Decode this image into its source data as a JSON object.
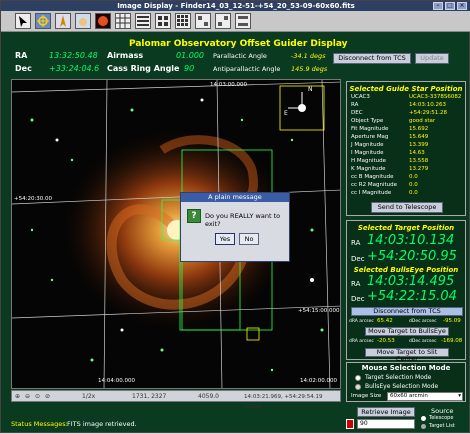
{
  "window": {
    "title": "Image Display - Finder14_03_12-51-+54_20_53-09-60x60.fits"
  },
  "toolbar": {
    "icons": [
      "pointer-icon",
      "crosshair-icon",
      "compass-icon",
      "hand-icon",
      "circle-icon",
      "grid-icon",
      "table-icon",
      "table-2-icon",
      "grid-3-icon",
      "grid-4-icon",
      "grid-5-icon",
      "grid-6-icon",
      "layout-icon"
    ]
  },
  "header": {
    "title": "Palomar Observatory Offset Guider Display",
    "ra_label": "RA",
    "ra_value": "13:32:50.48",
    "dec_label": "Dec",
    "dec_value": "+33:24:04.6",
    "airmass_label": "Airmass",
    "airmass_value": "01.000",
    "cass_label": "Cass Ring Angle",
    "cass_value": "90",
    "parallactic_label": "Parallactic Angle",
    "parallactic_value": "-34.1 degs",
    "antiparallactic_label": "Antiparallactic Angle",
    "antiparallactic_value": "145.9 degs",
    "disconnect_label": "Disconnect from TCS",
    "update_label": "Update"
  },
  "image": {
    "grid_labels": {
      "top": "14:03:00.000",
      "left": "+54:20:30.00",
      "right": "+54:15:00.000",
      "bottom_left": "14:04:00.000",
      "bottom_right": "14:02:00.000"
    },
    "compass": {
      "n": "N",
      "e": "E"
    },
    "zoom": "1/2x",
    "pixel": "1731, 2327",
    "value": "4059.0",
    "coords": "14:03:21.969, +54:29:54.19 (2000)"
  },
  "dialog": {
    "title": "A plain message",
    "message": "Do you REALLY want to exit?",
    "yes": "Yes",
    "no": "No"
  },
  "guide_star": {
    "title": "Selected Guide Star Position",
    "rows": [
      {
        "label": "UCAC3",
        "value": "UCAC3-3378S6082"
      },
      {
        "label": "RA",
        "value": "14:03:10.263"
      },
      {
        "label": "DEC",
        "value": "+54:29:51.28"
      },
      {
        "label": "Object Type",
        "value": "good star"
      },
      {
        "label": "Fit Magnitude",
        "value": "15.692"
      },
      {
        "label": "Aperture Mag",
        "value": "15.649"
      },
      {
        "label": "J Magnitude",
        "value": "13.399"
      },
      {
        "label": "I Magnitude",
        "value": "14.63"
      },
      {
        "label": "H Magnitude",
        "value": "13.558"
      },
      {
        "label": "K Magnitude",
        "value": "13.279"
      },
      {
        "label": "cc B Magnitude",
        "value": "0.0"
      },
      {
        "label": "cc R2 Magnitude",
        "value": "0.0"
      },
      {
        "label": "cc I Magnitude",
        "value": "0.0"
      }
    ],
    "send_label": "Send to Telescope"
  },
  "target": {
    "title": "Selected Target Position",
    "ra_label": "RA",
    "ra_value": "14:03:10.134",
    "dec_label": "Dec",
    "dec_value": "+54:20:50.95",
    "bulls_title": "Selected BullsEye Position",
    "bulls_ra": "14:03:14.495",
    "bulls_dec": "+54:22:15.04",
    "disconnect_label": "Disconnect from TCS",
    "offset1_ra_label": "dRA arcsec",
    "offset1_ra": "65.42",
    "offset1_dec_label": "dDec arcsec",
    "offset1_dec": "-95.09",
    "move_bulls_label": "Move Target to BullsEye",
    "offset2_ra_label": "dRA arcsec",
    "offset2_ra": "-20.53",
    "offset2_dec_label": "dDec arcsec",
    "offset2_dec": "-169.08",
    "move_slit_label": "Move Target to Slit Center"
  },
  "mouse": {
    "title": "Mouse Selection Mode",
    "opt1": "Target Selection Mode",
    "opt2": "BullsEye Selection Mode",
    "size_label": "Image Size",
    "size_value": "60x60 arcmin"
  },
  "footer": {
    "status_label": "Status Messages:",
    "status_text": "FITS image retrieved.",
    "retrieve_label": "Retrieve Image",
    "source_label": "Source",
    "telescope_label": "Telescope",
    "target_list_label": "Target List",
    "field_value": "90"
  }
}
